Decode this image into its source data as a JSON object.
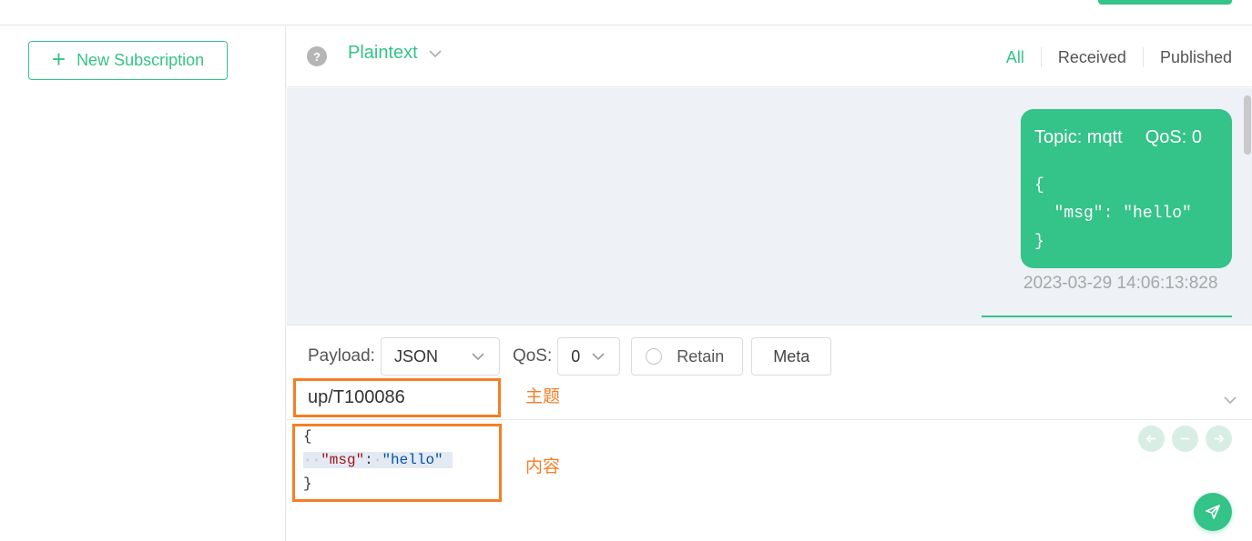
{
  "left_panel": {
    "new_subscription_label": "New Subscription"
  },
  "header": {
    "help_icon": "?",
    "format_label": "Plaintext",
    "filters": {
      "all": "All",
      "received": "Received",
      "published": "Published"
    }
  },
  "message": {
    "topic_text": "Topic: mqtt",
    "qos_text": "QoS: 0",
    "body": "{\n  \"msg\": \"hello\"\n}",
    "timestamp": "2023-03-29 14:06:13:828"
  },
  "publish": {
    "payload_label": "Payload:",
    "payload_value": "JSON",
    "qos_label": "QoS:",
    "qos_value": "0",
    "retain_label": "Retain",
    "meta_label": "Meta",
    "topic_value": "up/T100086",
    "topic_annotation": "主题",
    "payload_annotation": "内容",
    "code": {
      "open": "{",
      "key": "\"msg\"",
      "colon": ":",
      "value": "\"hello\"",
      "close": "}"
    }
  },
  "colors": {
    "accent": "#34c388",
    "annotation": "#f57e25"
  }
}
